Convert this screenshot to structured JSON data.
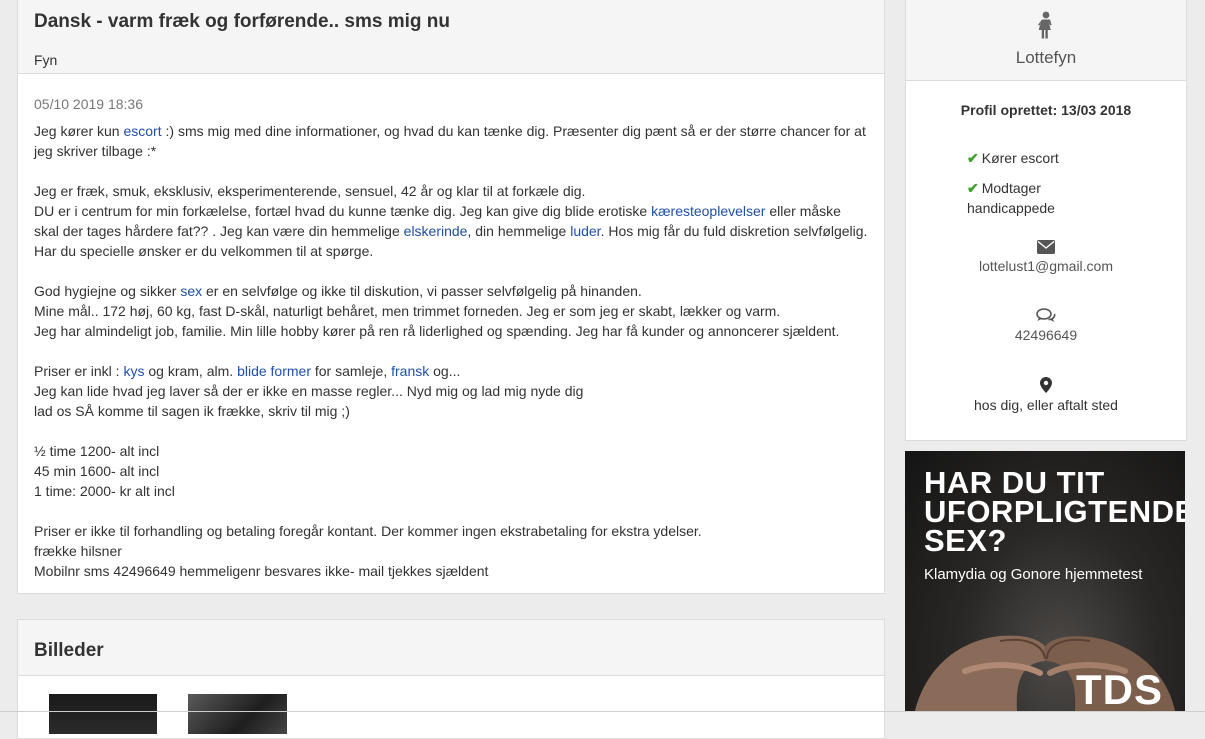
{
  "ad": {
    "title": "Dansk - varm fræk og forførende.. sms mig nu",
    "region": "Fyn",
    "date": "05/10 2019 18:36",
    "paragraphs": [
      [
        {
          "text": "Jeg kører kun "
        },
        {
          "text": "escort",
          "link": true
        },
        {
          "text": " :) sms mig med dine informationer, og hvad du kan tænke dig. Præsenter dig pænt så er der større chancer for at jeg skriver tilbage :*"
        }
      ],
      [
        {
          "text": "Jeg er fræk, smuk, eksklusiv, eksperimenterende, sensuel, 42 år og klar til at forkæle dig."
        },
        {
          "br": true
        },
        {
          "text": "DU er i centrum for min forkælelse, fortæl hvad du kunne tænke dig. Jeg kan give dig blide erotiske "
        },
        {
          "text": "kæresteoplevelser",
          "link": true
        },
        {
          "text": " eller måske skal der tages hårdere fat?? . Jeg kan være din hemmelige "
        },
        {
          "text": "elskerinde",
          "link": true
        },
        {
          "text": ", din hemmelige "
        },
        {
          "text": "luder",
          "link": true
        },
        {
          "text": ". Hos mig får du fuld diskretion selvfølgelig."
        },
        {
          "br": true
        },
        {
          "text": "Har du specielle ønsker er du velkommen til at spørge."
        }
      ],
      [
        {
          "text": "God hygiejne og sikker "
        },
        {
          "text": "sex",
          "link": true
        },
        {
          "text": " er en selvfølge og ikke til diskution, vi passer selvfølgelig på hinanden."
        },
        {
          "br": true
        },
        {
          "text": "Mine mål.. 172 høj, 60 kg, fast D-skål, naturligt behåret, men trimmet forneden. Jeg er som jeg er skabt, lækker og varm."
        },
        {
          "br": true
        },
        {
          "text": "Jeg har almindeligt job, familie. Min lille hobby kører på ren rå liderlighed og spænding. Jeg har få kunder og annoncerer sjældent."
        }
      ],
      [
        {
          "text": "Priser er inkl : "
        },
        {
          "text": "kys",
          "link": true
        },
        {
          "text": " og kram, alm. "
        },
        {
          "text": "blide former",
          "link": true
        },
        {
          "text": " for samleje, "
        },
        {
          "text": "fransk",
          "link": true
        },
        {
          "text": " og..."
        },
        {
          "br": true
        },
        {
          "text": "Jeg kan lide hvad jeg laver så der er ikke en masse regler... Nyd mig og lad mig nyde dig"
        },
        {
          "br": true
        },
        {
          "text": "lad os SÅ komme til sagen ik frække, skriv til mig ;)"
        }
      ],
      [
        {
          "text": "½ time 1200- alt incl"
        },
        {
          "br": true
        },
        {
          "text": "45 min 1600- alt incl"
        },
        {
          "br": true
        },
        {
          "text": "1 time: 2000- kr alt incl"
        }
      ],
      [
        {
          "text": "Priser er ikke til forhandling og betaling foregår kontant. Der kommer ingen ekstrabetaling for ekstra ydelser."
        },
        {
          "br": true
        },
        {
          "text": "frække hilsner"
        },
        {
          "br": true
        },
        {
          "text": "Mobilnr sms 42496649 hemmeligenr besvares ikke- mail tjekkes sjældent"
        }
      ]
    ]
  },
  "gallery": {
    "title": "Billeder"
  },
  "profile": {
    "gender_icon": "female-icon",
    "name": "Lottefyn",
    "created": "Profil oprettet: 13/03 2018",
    "checks": [
      "Kører escort",
      "Modtager handicappede"
    ],
    "email": "lottelust1@gmail.com",
    "phone": "42496649",
    "location": "hos dig, eller aftalt sted"
  },
  "banner": {
    "headline_lines": [
      "HAR DU TIT",
      "UFORPLIGTENDE",
      "SEX?"
    ],
    "subline": "Klamydia og Gonore hjemmetest",
    "logo": "TDS"
  },
  "colors": {
    "link": "#1f4fa8",
    "check": "#3ca12b",
    "page_bg": "#ececec"
  }
}
